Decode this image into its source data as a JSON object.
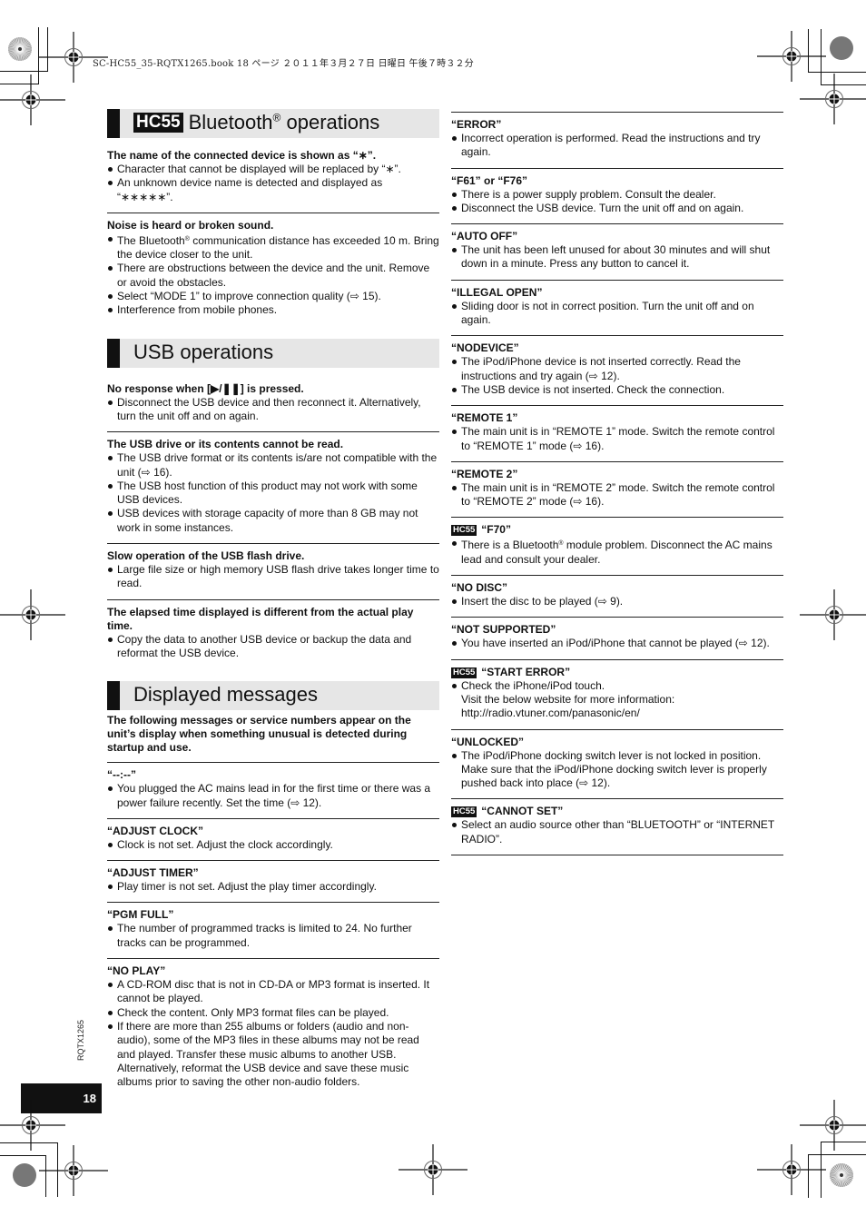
{
  "header": {
    "print_line": "SC-HC55_35-RQTX1265.book  18 ページ  ２０１１年３月２７日  日曜日  午後７時３２分"
  },
  "left": {
    "bluetooth": {
      "badge": "HC55",
      "title": "Bluetooth",
      "title_sup": "®",
      "title_suffix": " operations",
      "blocks": [
        {
          "question": "The name of the connected device is shown as “∗”.",
          "bullets": [
            "Character that cannot be displayed will be replaced by “∗”.",
            "An unknown device name is detected and displayed as “∗∗∗∗∗”."
          ]
        },
        {
          "question": "Noise is heard or broken sound.",
          "bullets": [
            "The Bluetooth® communication distance has exceeded 10 m. Bring the device closer to the unit.",
            "There are obstructions between the device and the unit. Remove or avoid the obstacles.",
            "Select “MODE 1” to improve connection quality (⇨ 15).",
            "Interference from mobile phones."
          ]
        }
      ]
    },
    "usb": {
      "title": "USB operations",
      "blocks": [
        {
          "question": "No response when [▶/❚❚] is pressed.",
          "bullets": [
            "Disconnect the USB device and then reconnect it. Alternatively, turn the unit off and on again."
          ]
        },
        {
          "question": "The USB drive or its contents cannot be read.",
          "bullets": [
            "The USB drive format or its contents is/are not compatible with the unit (⇨ 16).",
            "The USB host function of this product may not work with some USB devices.",
            "USB devices with storage capacity of more than 8 GB may not work in some instances."
          ]
        },
        {
          "question": "Slow operation of the USB flash drive.",
          "bullets": [
            "Large file size or high memory USB flash drive takes longer time to read."
          ]
        },
        {
          "question": "The elapsed time displayed is different from the actual play time.",
          "bullets": [
            "Copy the data to another USB device or backup the data and reformat the USB device."
          ]
        }
      ]
    },
    "messages": {
      "title": "Displayed messages",
      "intro": "The following messages or service numbers appear on the unit’s display when something unusual is detected during startup and use.",
      "blocks": [
        {
          "question": "“--:--”",
          "bullets": [
            "You plugged the AC mains lead in for the first time or there was a power failure recently. Set the time (⇨ 12)."
          ]
        },
        {
          "question": "“ADJUST CLOCK”",
          "bullets": [
            "Clock is not set. Adjust the clock accordingly."
          ]
        },
        {
          "question": "“ADJUST TIMER”",
          "bullets": [
            "Play timer is not set. Adjust the play timer accordingly."
          ]
        },
        {
          "question": "“PGM FULL”",
          "bullets": [
            "The number of programmed tracks is limited to 24. No further tracks can be programmed."
          ]
        },
        {
          "question": "“NO PLAY”",
          "bullets": [
            "A CD-ROM disc that is not in CD-DA or MP3 format is inserted. It cannot be played.",
            "Check the content. Only MP3 format files can be played.",
            "If there are more than 255 albums or folders (audio and non-audio), some of the MP3 files in these albums may not be read and played. Transfer these music albums to another USB. Alternatively, reformat the USB device and save these music albums prior to saving the other non-audio folders."
          ]
        }
      ]
    }
  },
  "right": {
    "blocks": [
      {
        "badge": "",
        "question": "“ERROR”",
        "bullets": [
          "Incorrect operation is performed. Read the instructions and try again."
        ]
      },
      {
        "badge": "",
        "question": "“F61” or “F76”",
        "bullets": [
          "There is a power supply problem. Consult the dealer.",
          "Disconnect the USB device. Turn the unit off and on again."
        ]
      },
      {
        "badge": "",
        "question": "“AUTO OFF”",
        "bullets": [
          "The unit has been left unused for about 30 minutes and will shut down in a minute. Press any button to cancel it."
        ]
      },
      {
        "badge": "",
        "question": "“ILLEGAL OPEN”",
        "bullets": [
          "Sliding door is not in correct position. Turn the unit off and on again."
        ]
      },
      {
        "badge": "",
        "question": "“NODEVICE”",
        "bullets": [
          "The iPod/iPhone device is not inserted correctly. Read the instructions and try again (⇨ 12).",
          "The USB device is not inserted. Check the connection."
        ]
      },
      {
        "badge": "",
        "question": "“REMOTE 1”",
        "bullets": [
          "The main unit is in “REMOTE 1” mode. Switch the remote control to “REMOTE 1” mode (⇨ 16)."
        ]
      },
      {
        "badge": "",
        "question": "“REMOTE 2”",
        "bullets": [
          "The main unit is in “REMOTE 2” mode. Switch the remote control to “REMOTE 2” mode (⇨ 16)."
        ]
      },
      {
        "badge": "HC55",
        "question": "“F70”",
        "bullets": [
          "There is a Bluetooth® module problem. Disconnect the AC mains lead and consult your dealer."
        ]
      },
      {
        "badge": "",
        "question": "“NO DISC”",
        "bullets": [
          "Insert the disc to be played (⇨ 9)."
        ]
      },
      {
        "badge": "",
        "question": "“NOT SUPPORTED”",
        "bullets": [
          "You have inserted an iPod/iPhone that cannot be played (⇨ 12)."
        ]
      },
      {
        "badge": "HC55",
        "question": "“START ERROR”",
        "bullets": [
          "Check the iPhone/iPod touch.\nVisit the below website for more information:\nhttp://radio.vtuner.com/panasonic/en/"
        ]
      },
      {
        "badge": "",
        "question": "“UNLOCKED”",
        "bullets": [
          "The iPod/iPhone docking switch lever is not locked in position. Make sure that the iPod/iPhone docking switch lever is properly pushed back into place (⇨ 12)."
        ]
      },
      {
        "badge": "HC55",
        "question": "“CANNOT SET”",
        "bullets": [
          "Select an audio source other than “BLUETOOTH” or “INTERNET RADIO”."
        ]
      }
    ]
  },
  "footer": {
    "page_number": "18",
    "doc_code": "RQTX1265"
  }
}
